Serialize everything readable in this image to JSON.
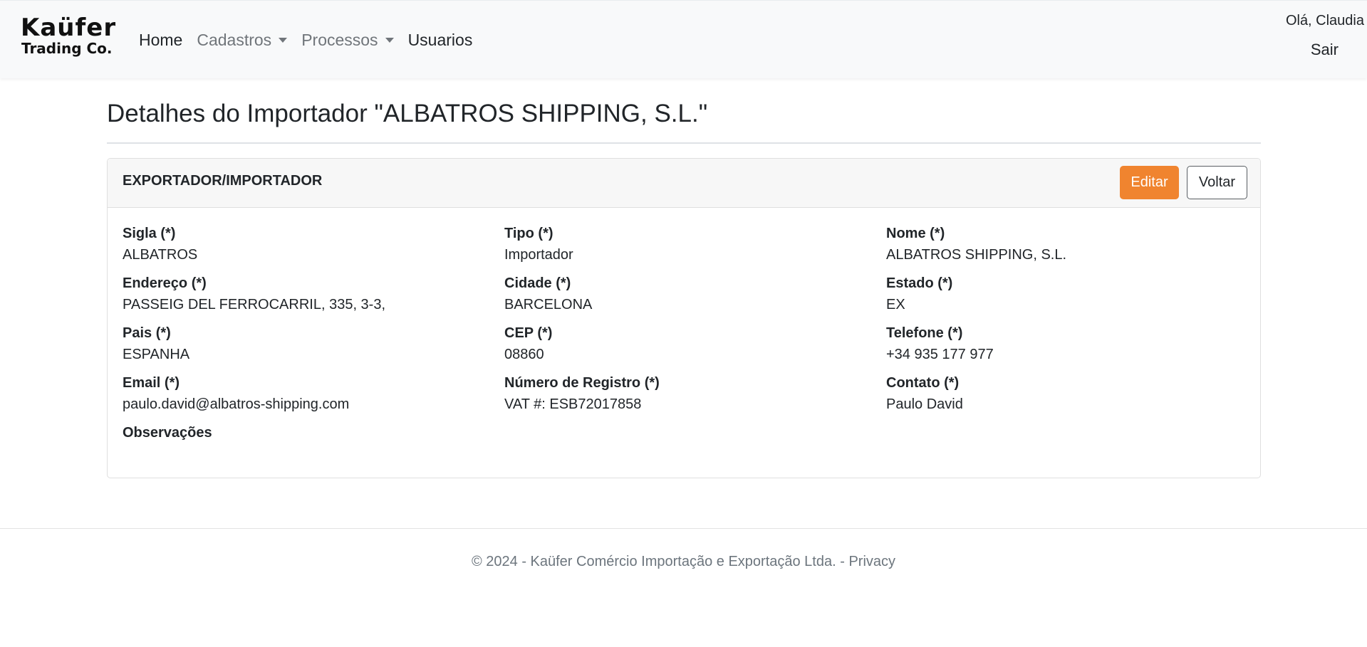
{
  "brand": {
    "line1": "Kaüfer",
    "line2": "Trading Co."
  },
  "nav": {
    "home": "Home",
    "cadastros": "Cadastros",
    "processos": "Processos",
    "usuarios": "Usuarios"
  },
  "user": {
    "greeting": "Olá, Claudia",
    "logout": "Sair"
  },
  "page": {
    "title": "Detalhes do Importador \"ALBATROS SHIPPING, S.L.\""
  },
  "card": {
    "header": "EXPORTADOR/IMPORTADOR",
    "edit_label": "Editar",
    "back_label": "Voltar"
  },
  "fields": {
    "sigla": {
      "label": "Sigla (*)",
      "value": "ALBATROS"
    },
    "tipo": {
      "label": "Tipo (*)",
      "value": "Importador"
    },
    "nome": {
      "label": "Nome (*)",
      "value": "ALBATROS SHIPPING, S.L."
    },
    "endereco": {
      "label": "Endereço (*)",
      "value": "PASSEIG DEL FERROCARRIL, 335, 3-3,"
    },
    "cidade": {
      "label": "Cidade (*)",
      "value": "BARCELONA"
    },
    "estado": {
      "label": "Estado (*)",
      "value": "EX"
    },
    "pais": {
      "label": "Pais (*)",
      "value": "ESPANHA"
    },
    "cep": {
      "label": "CEP (*)",
      "value": "08860"
    },
    "telefone": {
      "label": "Telefone (*)",
      "value": "+34 935 177 977"
    },
    "email": {
      "label": "Email (*)",
      "value": "paulo.david@albatros-shipping.com"
    },
    "registro": {
      "label": "Número de Registro (*)",
      "value": "VAT #: ESB72017858"
    },
    "contato": {
      "label": "Contato (*)",
      "value": "Paulo David"
    },
    "observacoes": {
      "label": "Observações",
      "value": ""
    }
  },
  "footer": {
    "text": "© 2024 - Kaüfer Comércio Importação e Exportação Ltda. - ",
    "privacy": "Privacy"
  },
  "colors": {
    "accent": "#f0842f",
    "navbar_bg": "#f8f9fa"
  }
}
